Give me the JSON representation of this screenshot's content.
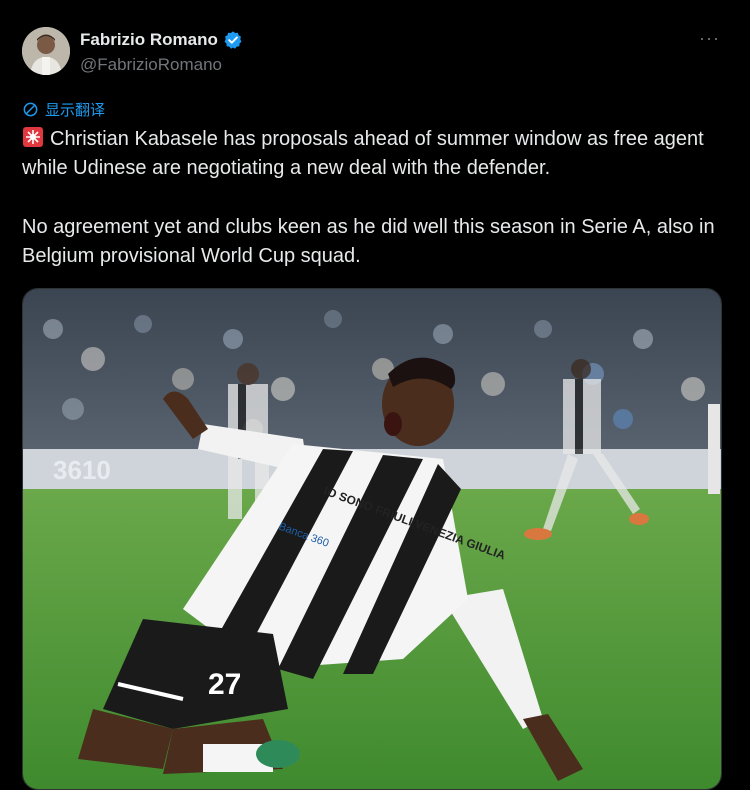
{
  "author": {
    "display_name": "Fabrizio Romano",
    "handle": "@FabrizioRomano",
    "verified": true,
    "verified_color": "#1d9bf0"
  },
  "menu": {
    "more_label": "···"
  },
  "translate": {
    "label": "显示翻译",
    "icon": "translate-icon"
  },
  "post": {
    "emoji": "rotating-light-emoji",
    "paragraph1": "Christian Kabasele has proposals ahead of summer window as free agent while Udinese are negotiating a new deal with the defender.",
    "paragraph2": "No agreement yet and clubs keen as he did well this season in Serie A, also in Belgium provisional World Cup squad."
  },
  "photo": {
    "shirt_sponsor": "IO SONO FRIULI VENEZIA GIULIA",
    "shirt_badge": "Banca 360",
    "shirt_number": "27",
    "board_text": "3610"
  },
  "colors": {
    "background": "#000000",
    "text": "#e7e9ea",
    "secondary": "#71767b",
    "link": "#1d9bf0"
  }
}
